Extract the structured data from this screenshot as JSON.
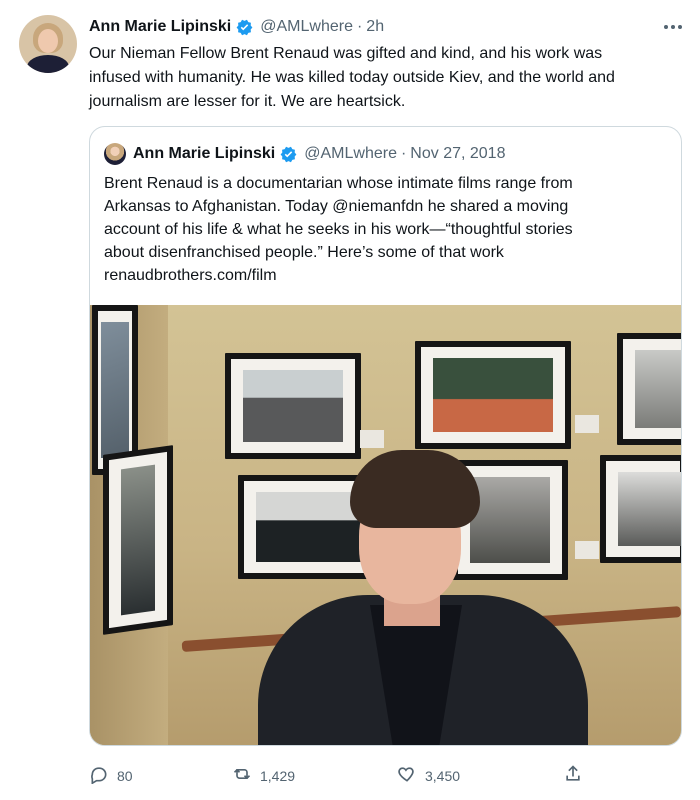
{
  "tweet": {
    "author_name": "Ann Marie Lipinski",
    "handle": "@AMLwhere",
    "separator": "·",
    "time": "2h",
    "text_lines": [
      "Our Nieman Fellow Brent Renaud was gifted and kind, and his work was",
      "infused with humanity. He was killed today outside Kiev, and the world and",
      "journalism are lesser for it. We are heartsick."
    ],
    "icons": {
      "avatar": "author-avatar",
      "verified": "verified-badge-icon",
      "more": "more-options-icon"
    }
  },
  "quoted_tweet": {
    "author_name": "Ann Marie Lipinski",
    "handle": "@AMLwhere",
    "separator": "·",
    "date": "Nov 27, 2018",
    "text_lines": [
      "Brent Renaud is a documentarian whose intimate films range from",
      "Arkansas to Afghanistan. Today @niemanfdn he shared a moving",
      "account of his life & what he seeks in his work—“thoughtful stories",
      "about disenfranchised people.” Here’s some of that work",
      "renaudbrothers.com/film"
    ]
  },
  "actions": {
    "reply_count": "80",
    "retweet_count": "1,429",
    "like_count": "3,450",
    "icons": [
      "reply-icon",
      "retweet-icon",
      "like-icon",
      "share-icon"
    ]
  },
  "colors": {
    "text": "#0f1419",
    "secondary": "#536471",
    "border": "#cfd9de",
    "verified": "#1d9bf0"
  }
}
